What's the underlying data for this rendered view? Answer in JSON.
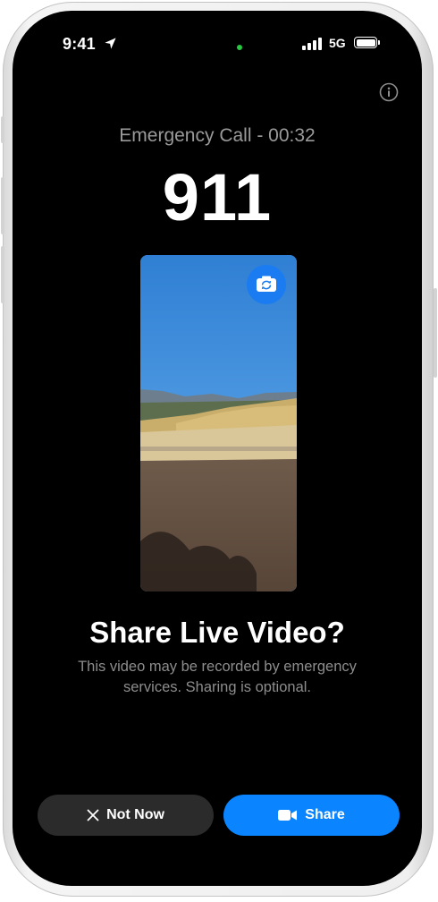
{
  "status_bar": {
    "time": "9:41",
    "network": "5G",
    "icons": [
      "location-arrow-icon",
      "signal-bars-icon",
      "battery-icon"
    ]
  },
  "call": {
    "label": "Emergency Call - 00:32",
    "number": "911"
  },
  "info_button": {
    "icon": "info-icon"
  },
  "video_preview": {
    "flip_icon": "camera-flip-icon"
  },
  "prompt": {
    "title": "Share Live Video?",
    "description": "This video may be recorded by emergency services. Sharing is optional."
  },
  "actions": {
    "not_now_label": "Not Now",
    "not_now_icon": "close-icon",
    "share_label": "Share",
    "share_icon": "video-camera-icon"
  },
  "colors": {
    "background": "#000000",
    "share_button": "#0a84ff",
    "not_now_button": "#2b2b2b",
    "camera_indicator": "#28c940"
  }
}
